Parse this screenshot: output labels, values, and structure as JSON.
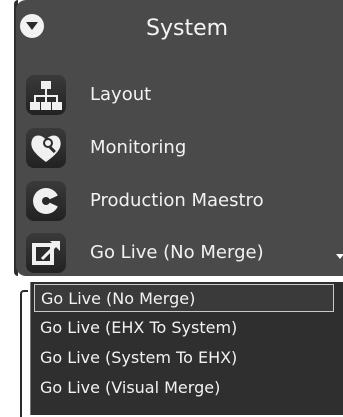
{
  "panel": {
    "title": "System",
    "items": [
      {
        "label": "Layout",
        "icon": "network-icon"
      },
      {
        "label": "Monitoring",
        "icon": "heart-search-icon"
      },
      {
        "label": "Production Maestro",
        "icon": "maestro-icon"
      },
      {
        "label": "Go Live (No Merge)",
        "icon": "go-live-icon"
      }
    ]
  },
  "dropdown": {
    "selected": "Go Live (No Merge)",
    "options": [
      "Go Live (No Merge)",
      "Go Live (EHX To System)",
      "Go Live (System To EHX)",
      "Go Live (Visual Merge)"
    ]
  },
  "colors": {
    "panel_bg": "#4a4a4a",
    "dropdown_bg": "#2f2f2f",
    "text": "#f2f2f2",
    "selected_border": "#c8c8c8"
  }
}
